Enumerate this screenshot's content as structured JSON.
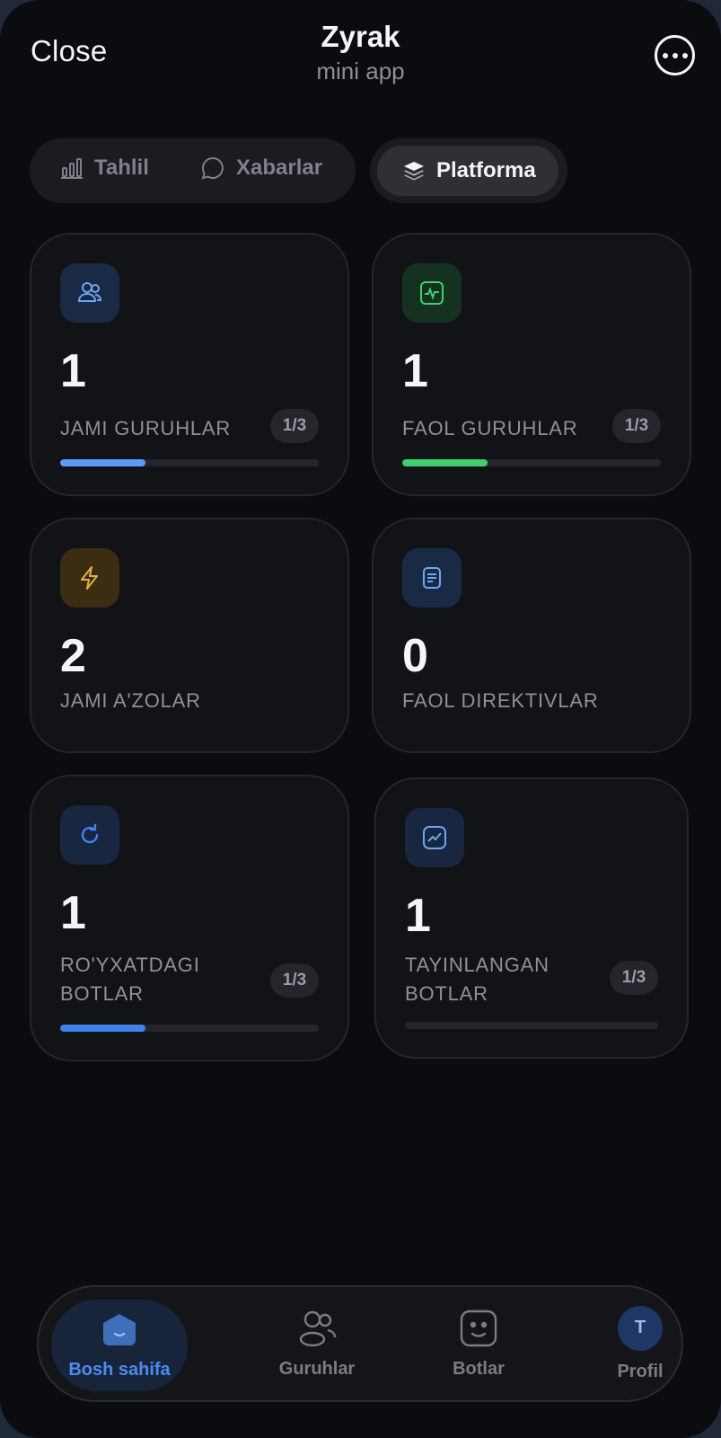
{
  "header": {
    "close_label": "Close",
    "title": "Zyrak",
    "subtitle": "mini app",
    "more_icon": "more-horizontal-icon"
  },
  "tabs": [
    {
      "label": "Tahlil",
      "icon": "bar-chart-icon",
      "active": false
    },
    {
      "label": "Xabarlar",
      "icon": "message-circle-icon",
      "active": false
    },
    {
      "label": "Platforma",
      "icon": "layers-icon",
      "active": true
    }
  ],
  "cards": [
    {
      "value": "1",
      "label": "JAMI GURUHLAR",
      "ratio": "1/3",
      "progress": 0.33,
      "icon": "users-icon",
      "accent": "#5b9cf5"
    },
    {
      "value": "1",
      "label": "FAOL GURUHLAR",
      "ratio": "1/3",
      "progress": 0.33,
      "icon": "activity-icon",
      "accent": "#3ecf6e"
    },
    {
      "value": "2",
      "label": "JAMI A'ZOLAR",
      "icon": "zap-icon",
      "accent": "#e3b341"
    },
    {
      "value": "0",
      "label": "FAOL DIREKTIVLAR",
      "icon": "document-icon",
      "accent": "#5b9cf5"
    },
    {
      "value": "1",
      "label": "RO'YXATDAGI BOTLAR",
      "ratio": "1/3",
      "progress": 0.33,
      "icon": "refresh-icon",
      "accent": "#3f82ec"
    },
    {
      "value": "1",
      "label": "TAYINLANGAN BOTLAR",
      "ratio": "1/3",
      "progress": 0,
      "icon": "trend-chart-icon",
      "accent": "#5b9cf5"
    }
  ],
  "nav": [
    {
      "label": "Bosh sahifa",
      "icon": "home-icon",
      "active": true
    },
    {
      "label": "Guruhlar",
      "icon": "users-icon",
      "active": false
    },
    {
      "label": "Botlar",
      "icon": "bot-face-icon",
      "active": false
    },
    {
      "label": "Profil",
      "icon": "avatar",
      "avatar_letter": "T",
      "active": false
    }
  ]
}
